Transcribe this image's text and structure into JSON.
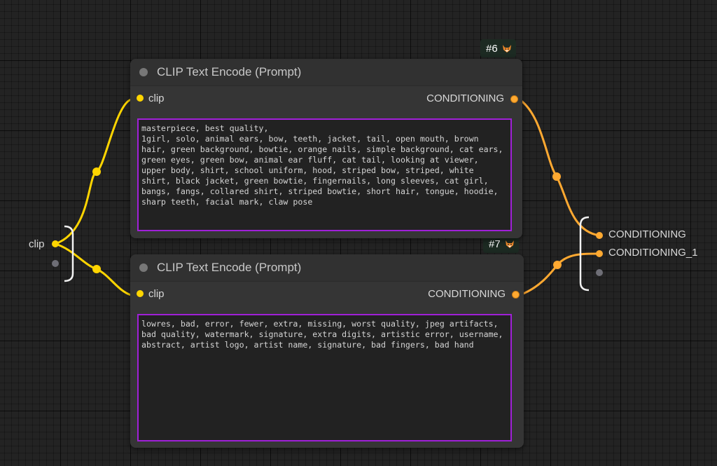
{
  "nodes": [
    {
      "id_badge": "#6",
      "title": "CLIP Text Encode (Prompt)",
      "input_label": "clip",
      "output_label": "CONDITIONING",
      "prompt_text": "masterpiece, best quality,\n1girl, solo, animal ears, bow, teeth, jacket, tail, open mouth, brown\nhair, green background, bowtie, orange nails, simple background, cat ears,\ngreen eyes, green bow, animal ear fluff, cat tail, looking at viewer,\nupper body, shirt, school uniform, hood, striped bow, striped, white\nshirt, black jacket, green bowtie, fingernails, long sleeves, cat girl,\nbangs, fangs, collared shirt, striped bowtie, short hair, tongue, hoodie,\nsharp teeth, facial mark, claw pose"
    },
    {
      "id_badge": "#7",
      "title": "CLIP Text Encode (Prompt)",
      "input_label": "clip",
      "output_label": "CONDITIONING",
      "prompt_text": "lowres, bad, error, fewer, extra, missing, worst quality, jpeg artifacts,\nbad quality, watermark, signature, extra digits, artistic error, username,\nabstract, artist logo, artist name, signature, bad fingers, bad hand"
    }
  ],
  "left_reroute": {
    "label": "clip"
  },
  "right_reroute": {
    "labels": [
      "CONDITIONING",
      "CONDITIONING_1"
    ]
  },
  "colors": {
    "clip_wire": "#ffd500",
    "conditioning_wire": "#ffa931",
    "prompt_border": "#a020d8",
    "node_bg": "#353535",
    "canvas_bg": "#232323"
  },
  "icons": {
    "badge_icon": "fox-icon"
  }
}
